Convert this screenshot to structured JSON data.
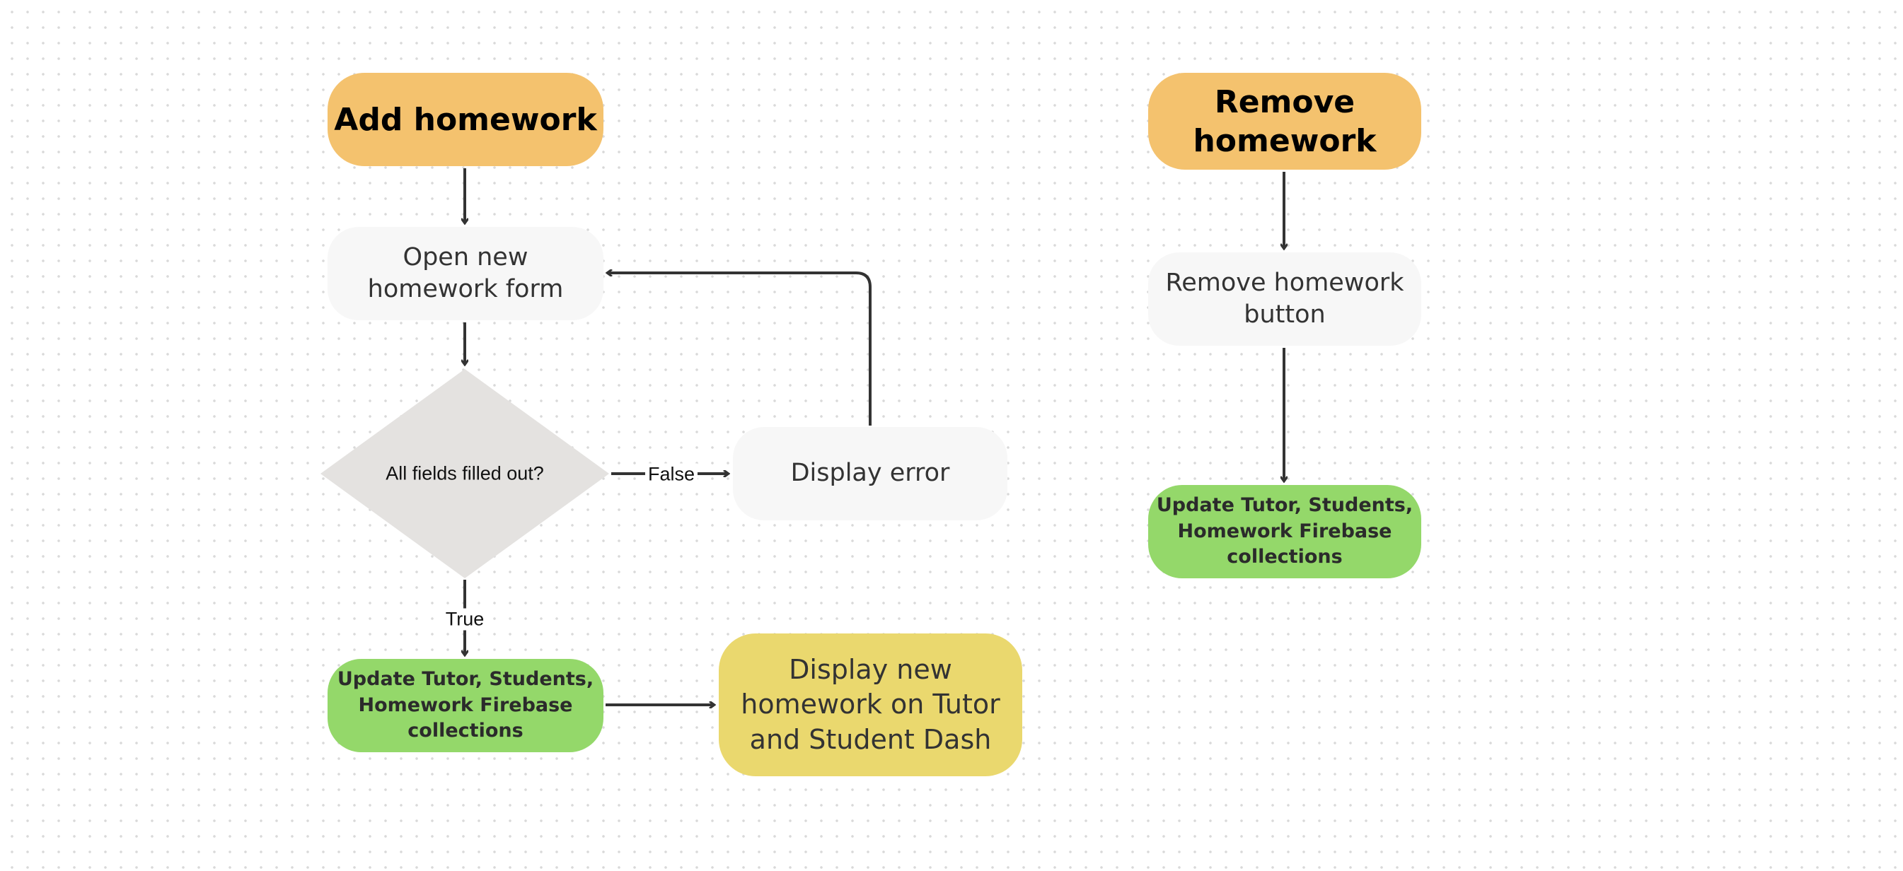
{
  "colors": {
    "start": "#F4C26E",
    "process": "#F7F7F7",
    "decision": "#E4E2E0",
    "update": "#94D86A",
    "display": "#EAD86E",
    "edge": "#333333"
  },
  "add_flow": {
    "start": "Add homework",
    "open_form": "Open new homework form",
    "decision": "All fields filled out?",
    "false_label": "False",
    "true_label": "True",
    "error": "Display error",
    "update": "Update Tutor, Students, Homework Firebase collections",
    "display": "Display new homework on Tutor and Student Dash"
  },
  "remove_flow": {
    "start": "Remove homework",
    "button": "Remove homework button",
    "update": "Update Tutor, Students, Homework Firebase collections"
  }
}
